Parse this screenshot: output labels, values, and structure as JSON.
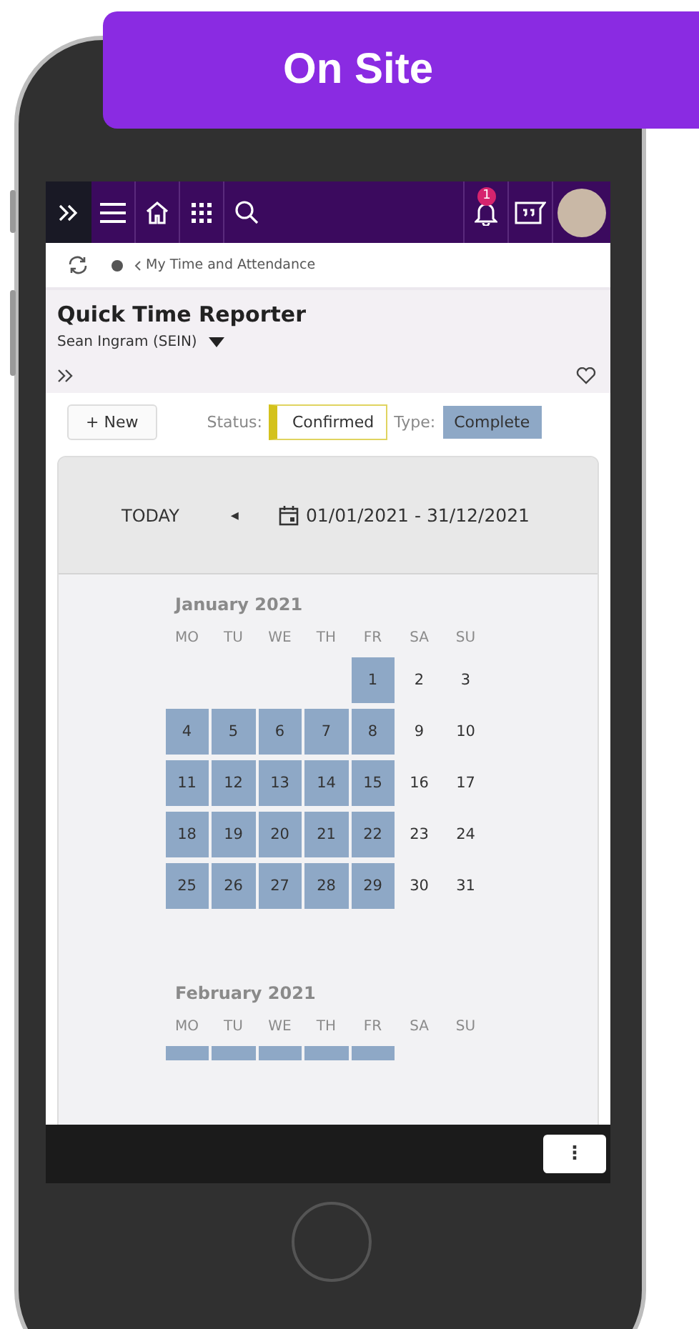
{
  "badge": {
    "label": "On Site"
  },
  "top_nav": {
    "notification_count": "1"
  },
  "breadcrumb": {
    "label": "My Time and Attendance"
  },
  "page": {
    "title": "Quick Time Reporter",
    "user": "Sean Ingram (SEIN)"
  },
  "toolbar": {
    "new_button": "+ New",
    "status_label": "Status:",
    "status_value": "Confirmed",
    "type_label": "Type:",
    "type_value": "Complete"
  },
  "calendar": {
    "today_button": "TODAY",
    "prev_button": "◂",
    "date_range": "01/01/2021 - 31/12/2021",
    "months": [
      {
        "title": "January 2021",
        "weekdays": [
          "MO",
          "TU",
          "WE",
          "TH",
          "FR",
          "SA",
          "SU"
        ],
        "weeks": [
          [
            {
              "day": "1",
              "selected": true
            },
            {
              "day": "2",
              "selected": false
            },
            {
              "day": "3",
              "selected": false
            }
          ],
          [
            {
              "day": "4",
              "selected": true
            },
            {
              "day": "5",
              "selected": true
            },
            {
              "day": "6",
              "selected": true
            },
            {
              "day": "7",
              "selected": true
            },
            {
              "day": "8",
              "selected": true
            },
            {
              "day": "9",
              "selected": false
            },
            {
              "day": "10",
              "selected": false
            }
          ],
          [
            {
              "day": "11",
              "selected": true
            },
            {
              "day": "12",
              "selected": true
            },
            {
              "day": "13",
              "selected": true
            },
            {
              "day": "14",
              "selected": true
            },
            {
              "day": "15",
              "selected": true
            },
            {
              "day": "16",
              "selected": false
            },
            {
              "day": "17",
              "selected": false
            }
          ],
          [
            {
              "day": "18",
              "selected": true
            },
            {
              "day": "19",
              "selected": true
            },
            {
              "day": "20",
              "selected": true
            },
            {
              "day": "21",
              "selected": true
            },
            {
              "day": "22",
              "selected": true
            },
            {
              "day": "23",
              "selected": false
            },
            {
              "day": "24",
              "selected": false
            }
          ],
          [
            {
              "day": "25",
              "selected": true
            },
            {
              "day": "26",
              "selected": true
            },
            {
              "day": "27",
              "selected": true
            },
            {
              "day": "28",
              "selected": true
            },
            {
              "day": "29",
              "selected": true
            },
            {
              "day": "30",
              "selected": false
            },
            {
              "day": "31",
              "selected": false
            }
          ]
        ]
      },
      {
        "title": "February 2021",
        "weekdays": [
          "MO",
          "TU",
          "WE",
          "TH",
          "FR",
          "SA",
          "SU"
        ],
        "weeks": [
          [
            {
              "selected": true
            },
            {
              "selected": true
            },
            {
              "selected": true
            },
            {
              "selected": true
            },
            {
              "selected": true
            }
          ]
        ]
      }
    ]
  },
  "bottom_bar": {
    "menu_button": "⋮"
  }
}
